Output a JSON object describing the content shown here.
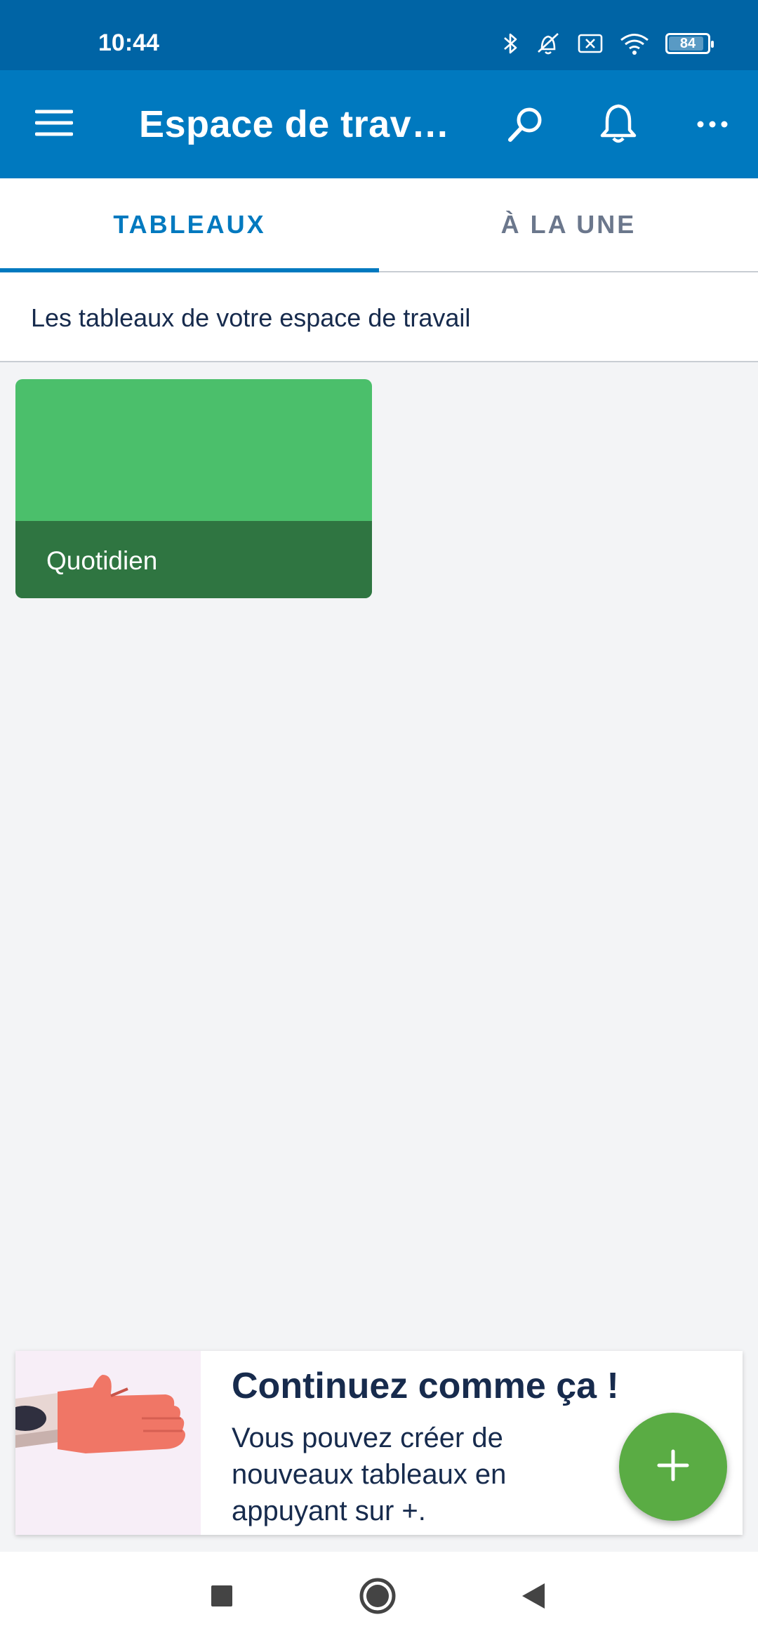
{
  "status_bar": {
    "time": "10:44",
    "battery": "84",
    "battery_level": 0.84,
    "icons": [
      "bluetooth-icon",
      "muted-alarm-icon",
      "sim-off-icon",
      "wifi-icon",
      "battery-icon"
    ]
  },
  "app_bar": {
    "title": "Espace de travai…",
    "icons": [
      "menu-icon",
      "search-icon",
      "bell-icon",
      "more-icon"
    ],
    "color": "#0079bf"
  },
  "tabs": [
    {
      "label": "TABLEAUX",
      "active": true
    },
    {
      "label": "À LA UNE",
      "active": false
    }
  ],
  "section": {
    "heading": "Les tableaux de votre espace de travail"
  },
  "boards": [
    {
      "name": "Quotidien",
      "color": "#4bbf6b"
    }
  ],
  "tip_card": {
    "title": "Continuez comme ça !",
    "body": "Vous pouvez créer de nouveaux tableaux en appuyant sur +.",
    "illustration": "thumbs-up-illustration"
  },
  "fab": {
    "icon": "plus-icon",
    "color": "#5aac44"
  },
  "nav_bar": {
    "icons": [
      "recents-icon",
      "home-icon",
      "back-icon"
    ]
  }
}
